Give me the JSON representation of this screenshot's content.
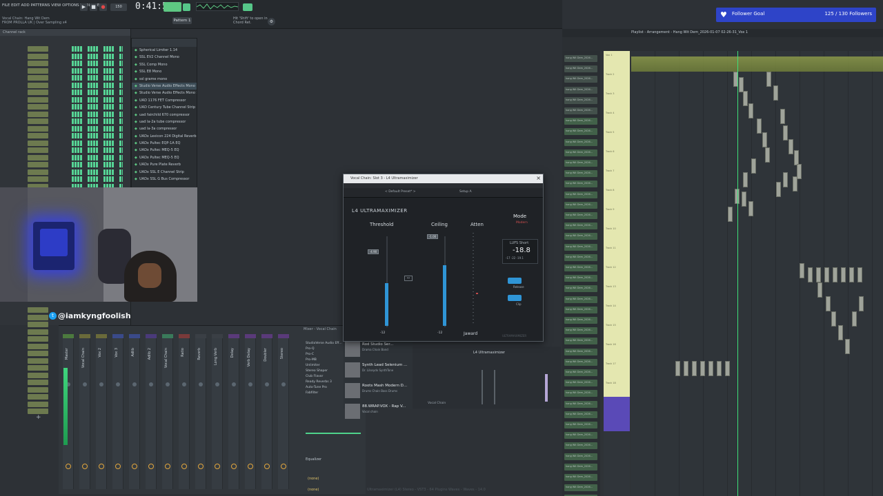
{
  "toolbar": {
    "menu": "FILE EDIT ADD PATTERNS VIEW OPTIONS TOOLS HELP",
    "song_line1": "Vocal Chain: Hang Wit Dem",
    "song_line2": "FROM PROLLA UK | Over Sampling x4",
    "time": "0:41:56",
    "pattern_label": "Pattern 1",
    "hint_line1": "Hit 'Shift' to open in",
    "hint_line2": "Chord Ret."
  },
  "browser": {
    "items": [
      "Spherical Limiter 1.14",
      "SSL EV2 Channel Mono",
      "SSL Comp Mono",
      "SSL E8 Mono",
      "ssl grame mono",
      "Studio Verse Audio Effects Mono",
      "Studio Verse Audio Effects Mono Stereo",
      "UAD 1176 FET Compressor",
      "UAD Century Tube Channel Strip",
      "uad fairchild 670 compressor",
      "uad la-2a tube compressor",
      "uad la-3a compressor",
      "UADx Lexicon 224 Digital Reverb",
      "UADx Pultec EQP-1A EQ",
      "UADx Pultec MEQ-5 EQ",
      "UADx Pultec MEQ-5 EQ",
      "UADx Pure Plate Reverb",
      "UADx SSL E Channel Strip",
      "UADx SSL G Bus Compressor"
    ]
  },
  "webcam": {
    "handle": "@iamkyngfoolish"
  },
  "mixer": {
    "title": "Mixer - Vocal Chain",
    "strips": [
      "Master",
      "Vocal Chain",
      "Vox 2",
      "Vox 3",
      "Adlib",
      "Adlib 2",
      "Vocal Chain",
      "Ratio",
      "Reverb",
      "Long Verb",
      "Delay",
      "Verb Delay",
      "Doubler",
      "Stereo"
    ],
    "inserts": [
      "StudioVerse Audio Eff...",
      "Pro-Q",
      "Pro-C",
      "Pro-MB",
      "Unlimiter",
      "Stereo Shaper",
      "Club Flavor",
      "Ready Reverbs 3",
      "Auto-Tune Pro",
      "Fabfilter"
    ],
    "eq_label": "Equalizer",
    "outputs": [
      "(none)",
      "(none)"
    ]
  },
  "plugin_list": [
    {
      "title": "Rod Studio Ser...",
      "sub": "Drama Chain Band"
    },
    {
      "title": "Synth Lead Selenium ...",
      "sub": "Dr. Lilseydx SynthTone"
    },
    {
      "title": "Roots Mash Modern D...",
      "sub": "Drums Chain Bass Drums"
    },
    {
      "title": "88.WRAP.VOX - Rap V...",
      "sub": "Vocal chain"
    }
  ],
  "vocal_chain": {
    "label": "Vocal Chain",
    "l4": "L4 Ultramaximizer"
  },
  "l4": {
    "title": "Vocal Chain: Slot 3 - L4 Ultramaximizer",
    "preset": "< Default Preset* >",
    "setA": "Setup A",
    "brand": "L4 ULTRAMAXIMIZER",
    "threshold_label": "Threshold",
    "ceiling_label": "Ceiling",
    "atten_label": "Atten",
    "threshold_val": "-4.90",
    "ceiling_val": "-1.00",
    "scale_bottom_left": "-12",
    "scale_bottom_mid": "-12",
    "link": "↔",
    "mode_label": "Mode",
    "mode_val": "Modern",
    "lufs_title": "LUFS Short",
    "lufs_val": "-18.8",
    "lufs_sub": "-17   -22   -19.1",
    "toggle1_label": "Release",
    "toggle2_label": "Clip",
    "footer": "Jaward",
    "footer_r": "ULTRAMAXIMIZER"
  },
  "playlist": {
    "title": "Playlist - Arrangement - Hang Wit Dem_2026-01-07 02-26-31_Vox 1",
    "patterns": [
      "hang Wit Dem_2026...",
      "hang Wit Dem_2026...",
      "hang Wit Dem_2026...",
      "hang Wit Dem_2026...",
      "hang Wit Dem_2026...",
      "hang Wit Dem_2026...",
      "hang Wit Dem_2026...",
      "hang Wit Dem_2026...",
      "hang Wit Dem_2026...",
      "hang Wit Dem_2026...",
      "hang Wit Dem_2026...",
      "hang Wit Dem_2026...",
      "hang Wit Dem_2026...",
      "hang Wit Dem_2026...",
      "hang Wit Dem_2026...",
      "hang Wit Dem_2026...",
      "hang Wit Dem_2026...",
      "hang Wit Dem_2026...",
      "hang Wit Dem_2026...",
      "hang Wit Dem_2026...",
      "hang Wit Dem_2026...",
      "hang Wit Dem_2026...",
      "hang Wit Dem_2026...",
      "hang Wit Dem_2026...",
      "hang Wit Dem_2026...",
      "hang Wit Dem_2026...",
      "hang Wit Dem_2026...",
      "hang Wit Dem_2026...",
      "hang Wit Dem_2026...",
      "hang Wit Dem_2026...",
      "hang Wit Dem_2026...",
      "hang Wit Dem_2026...",
      "hang Wit Dem_2026...",
      "hang Wit Dem_2026...",
      "hang Wit Dem_2026...",
      "hang Wit Dem_2026...",
      "hang Wit Dem_2026...",
      "hang Wit Dem_2026...",
      "hang Wit Dem_2026...",
      "hang Wit Dem_2026...",
      "hang Wit Dem_2026...",
      "hang Wit Dem_2026...",
      "hang Wit Dem_2026..."
    ],
    "tracks": [
      "Vox 1",
      "Track 2",
      "Track 3",
      "Track 4",
      "Track 5",
      "Track 6",
      "Track 7",
      "Track 8",
      "Track 9",
      "Track 10",
      "Track 11",
      "Track 12",
      "Track 13",
      "Track 14",
      "Track 15",
      "Track 16",
      "Track 17",
      "Track 18"
    ]
  },
  "follower": {
    "label": "Follower Goal",
    "count": "125 / 130 Followers"
  },
  "footer": "Ultramaximizer (L4) Stereo - VST3 - 64 Plugins Waves - Waves - 14.0"
}
